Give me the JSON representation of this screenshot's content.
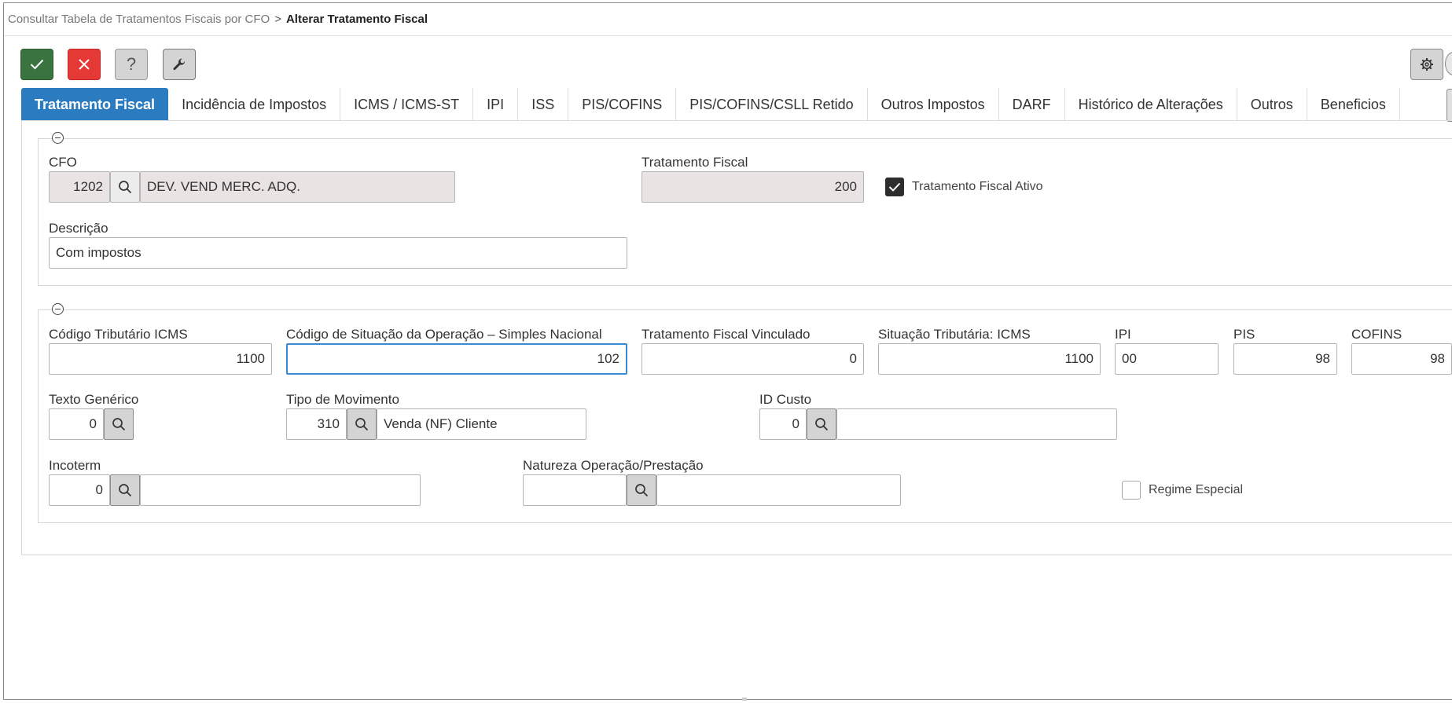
{
  "breadcrumb": {
    "parent": "Consultar Tabela de Tratamentos Fiscais por CFO",
    "separator": ">",
    "current": "Alterar Tratamento Fiscal"
  },
  "toolbar": {
    "confirm_icon": "check-icon",
    "cancel_icon": "close-icon",
    "help_label": "?",
    "tools_icon": "wrench-icon",
    "settings_icon": "gear-icon"
  },
  "tabs": [
    {
      "label": "Tratamento Fiscal",
      "active": true
    },
    {
      "label": "Incidência de Impostos"
    },
    {
      "label": "ICMS / ICMS-ST"
    },
    {
      "label": "IPI"
    },
    {
      "label": "ISS"
    },
    {
      "label": "PIS/COFINS"
    },
    {
      "label": "PIS/COFINS/CSLL Retido"
    },
    {
      "label": "Outros Impostos"
    },
    {
      "label": "DARF"
    },
    {
      "label": "Histórico de Alterações"
    },
    {
      "label": "Outros"
    },
    {
      "label": "Beneficios"
    }
  ],
  "section1": {
    "cfo": {
      "label": "CFO",
      "code": "1202",
      "description": "DEV. VEND MERC. ADQ."
    },
    "tratamento_fiscal": {
      "label": "Tratamento Fiscal",
      "value": "200"
    },
    "ativo": {
      "label": "Tratamento Fiscal Ativo",
      "checked": true
    },
    "descricao": {
      "label": "Descrição",
      "value": "Com impostos"
    }
  },
  "section2": {
    "codigo_tributario_icms": {
      "label": "Código Tributário ICMS",
      "value": "1100"
    },
    "csosn": {
      "label": "Código de Situação da Operação – Simples Nacional",
      "value": "102"
    },
    "tratamento_vinculado": {
      "label": "Tratamento Fiscal Vinculado",
      "value": "0"
    },
    "situacao_icms": {
      "label": "Situação Tributária: ICMS",
      "value": "1100"
    },
    "ipi": {
      "label": "IPI",
      "value": "00"
    },
    "pis": {
      "label": "PIS",
      "value": "98"
    },
    "cofins": {
      "label": "COFINS",
      "value": "98"
    },
    "texto_generico": {
      "label": "Texto Genérico",
      "value": "0"
    },
    "tipo_movimento": {
      "label": "Tipo de Movimento",
      "code": "310",
      "description": "Venda (NF) Cliente"
    },
    "id_custo": {
      "label": "ID Custo",
      "code": "0",
      "description": ""
    },
    "incoterm": {
      "label": "Incoterm",
      "code": "0",
      "description": ""
    },
    "natureza": {
      "label": "Natureza Operação/Prestação",
      "code": "",
      "description": ""
    },
    "regime_especial": {
      "label": "Regime Especial",
      "checked": false
    }
  },
  "colors": {
    "accent": "#2a7bbf",
    "confirm": "#3a7340",
    "cancel": "#e53935",
    "readonly_bg": "#e9e3e3",
    "focus": "#3a8ad6"
  }
}
